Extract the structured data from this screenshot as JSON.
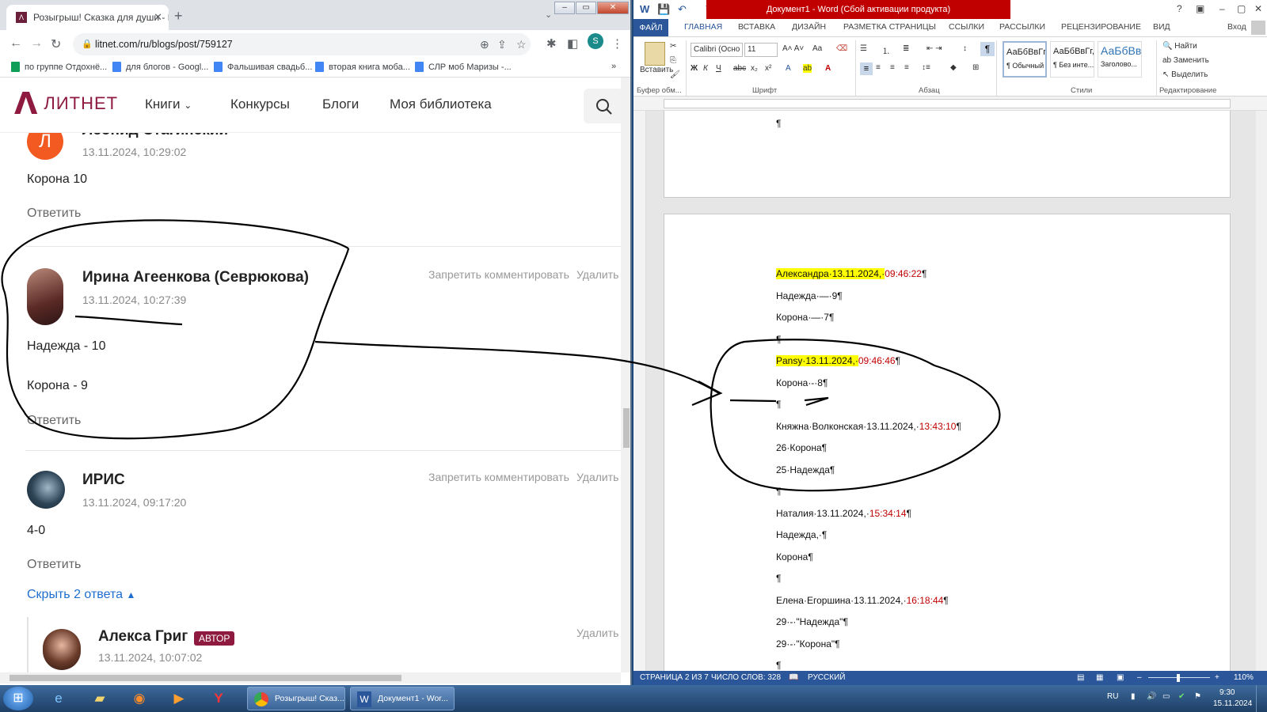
{
  "browser": {
    "tab_title": "Розыгрыш! Сказка для души - Б",
    "url": "litnet.com/ru/blogs/post/759127",
    "profile_letter": "S",
    "bookmarks": [
      "по группе Отдохнё...",
      "для блогов - Googl...",
      "Фальшивая свадьб...",
      "вторая книга моба...",
      "СЛР моб Маризы -..."
    ]
  },
  "site": {
    "logo_mark": "Λ",
    "logo_text": "ЛИТНЕТ",
    "nav": [
      "Книги",
      "Конкурсы",
      "Блоги",
      "Моя библиотека"
    ]
  },
  "comments": [
    {
      "author": "Леонид Стагинский",
      "avatar_letter": "Л",
      "date": "13.11.2024, 10:29:02",
      "lines": [
        "Корона 10"
      ],
      "reply": "Ответить"
    },
    {
      "author": "Ирина Агеенкова (Севрюкова)",
      "date": "13.11.2024, 10:27:39",
      "lines": [
        "Надежда - 10",
        "Корона - 9"
      ],
      "reply": "Ответить",
      "block": "Запретить комментировать",
      "delete": "Удалить"
    },
    {
      "author": "ИРИС",
      "date": "13.11.2024, 09:17:20",
      "lines": [
        "4-0"
      ],
      "reply": "Ответить",
      "block": "Запретить комментировать",
      "delete": "Удалить",
      "toggle": "Скрыть 2 ответа"
    },
    {
      "author": "Алекса Григ",
      "badge": "АВТОР",
      "date": "13.11.2024, 10:07:02",
      "delete": "Удалить"
    }
  ],
  "word": {
    "title": "Документ1 - Word (Сбой активации продукта)",
    "signin": "Вход",
    "tabs": [
      "ФАЙЛ",
      "ГЛАВНАЯ",
      "ВСТАВКА",
      "ДИЗАЙН",
      "РАЗМЕТКА СТРАНИЦЫ",
      "ССЫЛКИ",
      "РАССЫЛКИ",
      "РЕЦЕНЗИРОВАНИЕ",
      "ВИД"
    ],
    "paste_label": "Вставить",
    "font_name": "Calibri (Осно",
    "font_size": "11",
    "groups": [
      "Буфер обм...",
      "Шрифт",
      "Абзац",
      "Стили",
      "Редактирование"
    ],
    "styles": [
      {
        "sample": "АаБбВвГг,",
        "name": "¶ Обычный"
      },
      {
        "sample": "АаБбВвГг,",
        "name": "¶ Без инте..."
      },
      {
        "sample": "АаБбВв",
        "name": "Заголово..."
      }
    ],
    "editing": [
      "Найти",
      "Заменить",
      "Выделить"
    ],
    "doc_lines": [
      {
        "name": "Александра·13.11.2024,·",
        "time": "09:46:22",
        "end": "¶",
        "hl": true
      },
      {
        "text": "Надежда·—·9¶"
      },
      {
        "text": "Корона·—·7¶"
      },
      {
        "text": "¶"
      },
      {
        "name": "Pansy·13.11.2024,·",
        "time": "09:46:46",
        "end": "¶",
        "hl": true
      },
      {
        "text": "Корона·-·8¶"
      },
      {
        "text": "¶"
      },
      {
        "name": "Княжна·Волконская·13.11.2024,·",
        "time": "13:43:10",
        "end": "¶"
      },
      {
        "text": "26·Корона¶"
      },
      {
        "text": "25·Надежда¶"
      },
      {
        "text": "¶"
      },
      {
        "name": "Наталия·13.11.2024,·",
        "time": "15:34:14",
        "end": "¶"
      },
      {
        "text": "Надежда,·¶"
      },
      {
        "text": "Корона¶"
      },
      {
        "text": "¶"
      },
      {
        "name": "Елена·Егоршина·13.11.2024,·",
        "time": "16:18:44",
        "end": "¶"
      },
      {
        "text": "29·-·\"Надежда\"¶"
      },
      {
        "text": "29·-·\"Корона\"¶"
      },
      {
        "text": "¶"
      }
    ],
    "top_para": "¶",
    "status": {
      "page": "СТРАНИЦА 2 ИЗ 7",
      "words": "ЧИСЛО СЛОВ: 328",
      "lang": "РУССКИЙ",
      "zoom": "110%"
    }
  },
  "taskbar": {
    "apps": [
      "Розыгрыш! Сказ...",
      "Документ1 - Wor..."
    ],
    "lang": "RU",
    "time": "9:30",
    "date": "15.11.2024"
  },
  "colors": {
    "brand": "#8e1b3f",
    "word_blue": "#2b579a",
    "activation_red": "#c00000",
    "link_blue": "#1f6fd0"
  }
}
